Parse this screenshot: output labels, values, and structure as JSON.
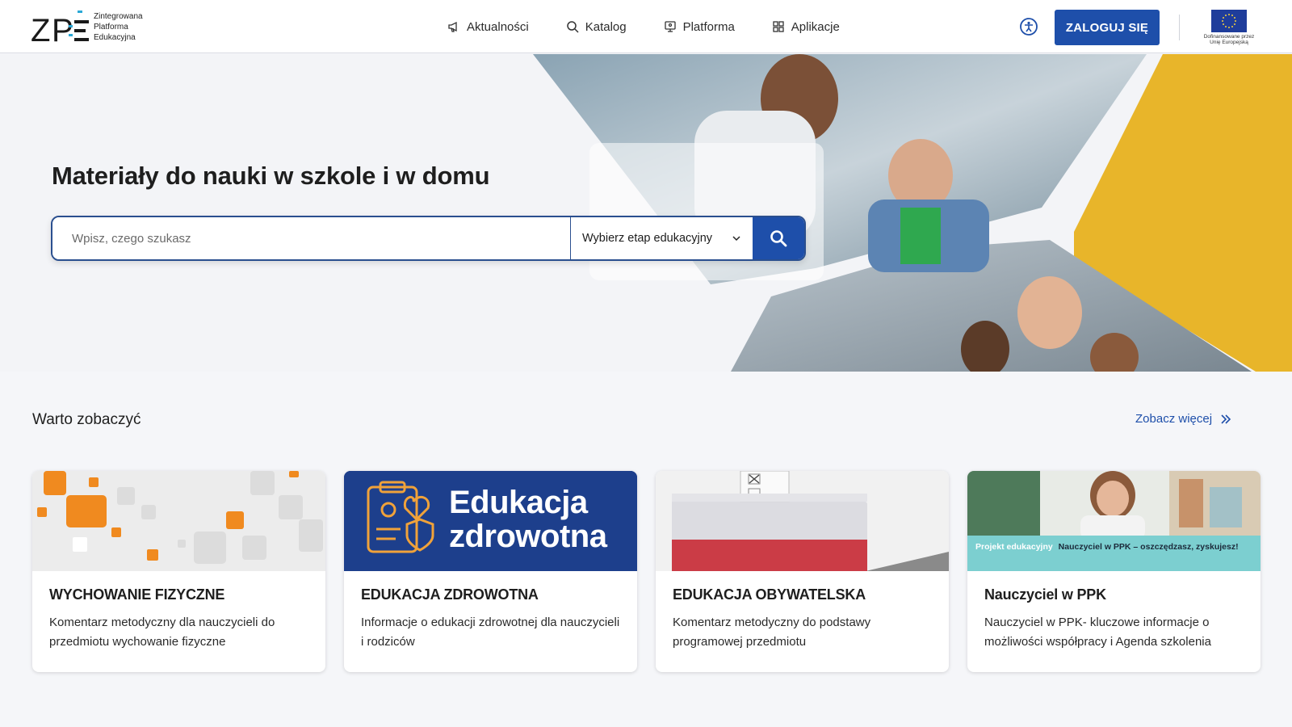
{
  "logo": {
    "text_line1": "Zintegrowana",
    "text_line2": "Platforma",
    "text_line3": "Edukacyjna"
  },
  "nav": [
    {
      "label": "Aktualności",
      "icon": "megaphone-icon"
    },
    {
      "label": "Katalog",
      "icon": "search-icon"
    },
    {
      "label": "Platforma",
      "icon": "monitor-icon"
    },
    {
      "label": "Aplikacje",
      "icon": "grid-icon"
    }
  ],
  "header": {
    "login_label": "ZALOGUJ SIĘ",
    "eu_line1": "Dofinansowane przez",
    "eu_line2": "Unię Europejską"
  },
  "hero": {
    "title": "Materiały do nauki w szkole i w domu",
    "search_placeholder": "Wpisz, czego szukasz",
    "select_label": "Wybierz etap edukacyjny"
  },
  "section": {
    "title": "Warto zobaczyć",
    "see_more": "Zobacz więcej"
  },
  "cards": [
    {
      "title": "WYCHOWANIE FIZYCZNE",
      "desc": "Komentarz metodyczny dla nauczycieli do przedmiotu wychowanie fizyczne"
    },
    {
      "title": "EDUKACJA ZDROWOTNA",
      "desc": "Informacje o edukacji zdrowotnej dla nauczycieli i rodziców",
      "img_text1": "Edukacja",
      "img_text2": "zdrowotna"
    },
    {
      "title": "EDUKACJA OBYWATELSKA",
      "desc": "Komentarz metodyczny do podstawy programowej przedmiotu"
    },
    {
      "title": "Nauczyciel w PPK",
      "desc": "Nauczyciel w PPK- kluczowe informacje o możliwości współpracy i Agenda szkolenia",
      "img_banner_label": "Projekt edukacyjny",
      "img_banner_text": "Nauczyciel w PPK – oszczędzasz, zyskujesz!"
    }
  ],
  "colors": {
    "primary": "#1e4faa",
    "accent_yellow": "#e8b52a",
    "orange": "#f08a1f"
  }
}
